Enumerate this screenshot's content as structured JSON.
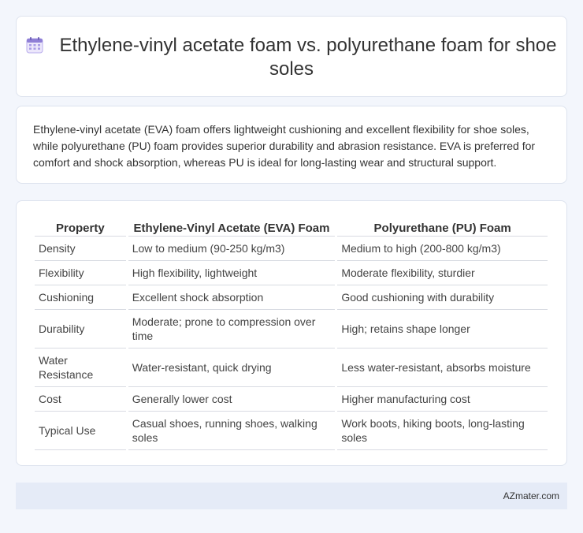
{
  "header": {
    "title": "Ethylene-vinyl acetate foam vs. polyurethane foam for shoe soles",
    "icon": "calendar-icon",
    "icon_color": "#8f7fd6"
  },
  "summary": {
    "text": "Ethylene-vinyl acetate (EVA) foam offers lightweight cushioning and excellent flexibility for shoe soles, while polyurethane (PU) foam provides superior durability and abrasion resistance. EVA is preferred for comfort and shock absorption, whereas PU is ideal for long-lasting wear and structural support."
  },
  "table": {
    "headers": [
      "Property",
      "Ethylene-Vinyl Acetate (EVA) Foam",
      "Polyurethane (PU) Foam"
    ],
    "rows": [
      [
        "Density",
        "Low to medium (90-250 kg/m3)",
        "Medium to high (200-800 kg/m3)"
      ],
      [
        "Flexibility",
        "High flexibility, lightweight",
        "Moderate flexibility, sturdier"
      ],
      [
        "Cushioning",
        "Excellent shock absorption",
        "Good cushioning with durability"
      ],
      [
        "Durability",
        "Moderate; prone to compression over time",
        "High; retains shape longer"
      ],
      [
        "Water Resistance",
        "Water-resistant, quick drying",
        "Less water-resistant, absorbs moisture"
      ],
      [
        "Cost",
        "Generally lower cost",
        "Higher manufacturing cost"
      ],
      [
        "Typical Use",
        "Casual shoes, running shoes, walking soles",
        "Work boots, hiking boots, long-lasting soles"
      ]
    ]
  },
  "footer": {
    "text": "AZmater.com"
  }
}
